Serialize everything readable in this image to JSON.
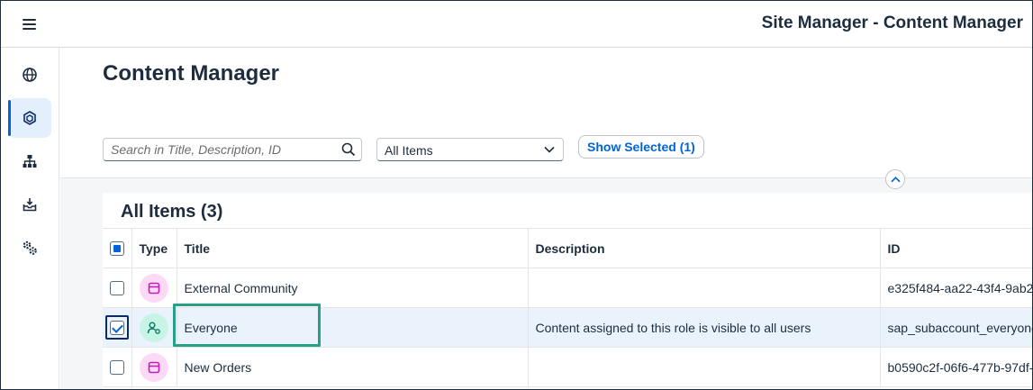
{
  "header": {
    "app_title": "Site Manager - Content Manager",
    "menu_icon": "hamburger-icon"
  },
  "sidenav": {
    "items": [
      {
        "icon": "globe-icon",
        "active": false
      },
      {
        "icon": "content-cube-icon",
        "active": true
      },
      {
        "icon": "hierarchy-icon",
        "active": false
      },
      {
        "icon": "inbox-download-icon",
        "active": false
      },
      {
        "icon": "settings-gears-icon",
        "active": false
      }
    ]
  },
  "page": {
    "title": "Content Manager"
  },
  "toolbar": {
    "search_placeholder": "Search in Title, Description, ID",
    "search_value": "",
    "filter_value": "All Items",
    "show_selected_label": "Show Selected (1)"
  },
  "table": {
    "title": "All Items (3)",
    "columns": [
      "Type",
      "Title",
      "Description",
      "ID"
    ],
    "rows": [
      {
        "type_icon": "page-icon",
        "title": "External Community",
        "description": "",
        "id": "e325f484-aa22-43f4-9ab2",
        "selected": false
      },
      {
        "type_icon": "role-icon",
        "title": "Everyone",
        "description": "Content assigned to this role is visible to all users",
        "id": "sap_subaccount_everyone",
        "selected": true
      },
      {
        "type_icon": "page-icon",
        "title": "New Orders",
        "description": "",
        "id": "b0590c2f-06f6-477b-97df-",
        "selected": false
      }
    ]
  },
  "colors": {
    "accent": "#0064d9",
    "selected_row": "#eaf3fc",
    "page_badge": "#fcdaf7",
    "role_badge": "#c8f4e8",
    "highlight": "#27a08a"
  }
}
